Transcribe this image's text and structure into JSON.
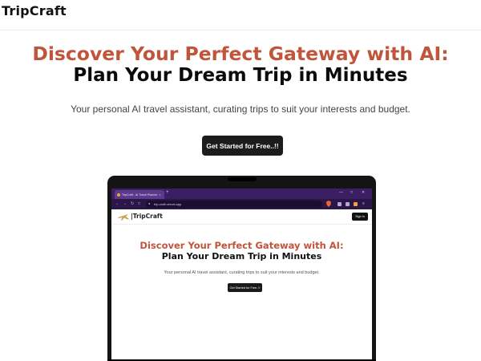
{
  "nav": {
    "brand": "TripCraft"
  },
  "hero": {
    "title_line1": "Discover Your Perfect Gateway with AI:",
    "title_line2": "Plan Your Dream Trip in Minutes",
    "subtitle": "Your personal AI travel assistant, curating trips to suit your interests and budget.",
    "cta_label": "Get Started for Free..!!"
  },
  "colors": {
    "accent": "#c0553b",
    "dark": "#1c1c1c",
    "browser_chrome": "#3a1f63"
  },
  "mockup": {
    "browser": {
      "tab_title": "TripCraft - AI Travel Planner",
      "tab_close": "×",
      "new_tab": "+",
      "url": "trip-craft.vercel.app"
    },
    "page": {
      "brand": "|TripCraft",
      "signin_label": "Sign In",
      "title_line1": "Discover Your Perfect Gateway with AI:",
      "title_line2": "Plan Your Dream Trip in Minutes",
      "subtitle": "Your personal AI travel assistant, curating trips to suit your interests and budget.",
      "cta_label": "Get Started for Free..!!"
    }
  }
}
